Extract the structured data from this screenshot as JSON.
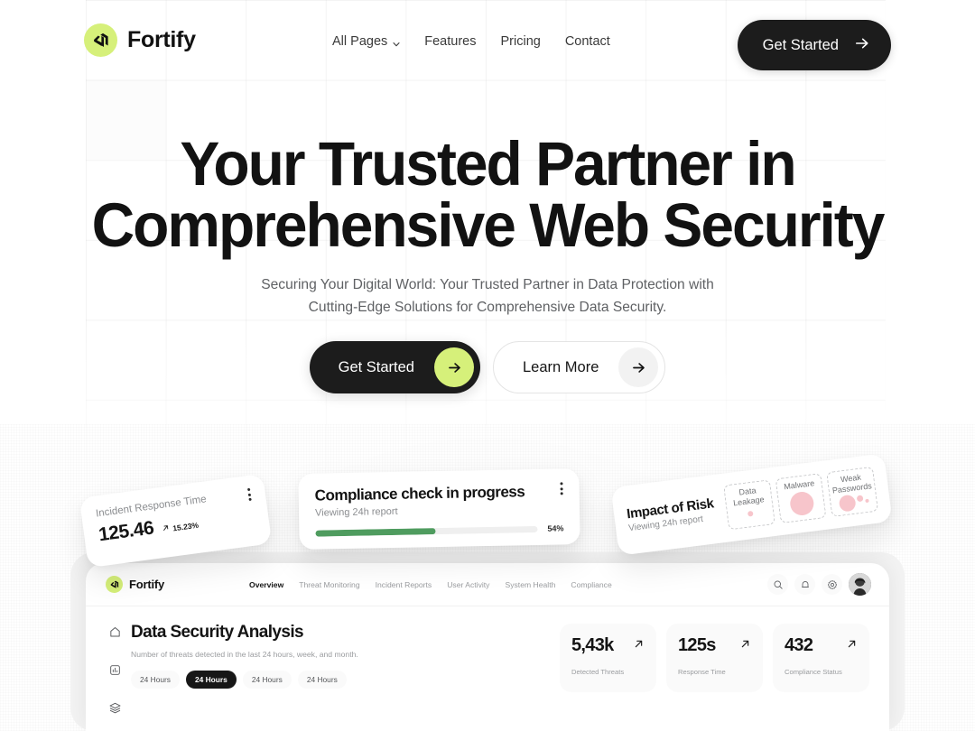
{
  "header": {
    "brand": "Fortify",
    "logo_icon": "fortify-logo-icon",
    "nav": [
      {
        "label": "All Pages",
        "has_chevron": true
      },
      {
        "label": "Features",
        "has_chevron": false
      },
      {
        "label": "Pricing",
        "has_chevron": false
      },
      {
        "label": "Contact",
        "has_chevron": false
      }
    ],
    "cta_label": "Get Started",
    "cta_icon": "arrow-right-icon"
  },
  "hero": {
    "title_line1": "Your Trusted Partner in",
    "title_line2": "Comprehensive Web Security",
    "subtitle": "Securing Your Digital World: Your Trusted Partner in Data Protection with Cutting-Edge Solutions for Comprehensive Data Security.",
    "primary_label": "Get Started",
    "secondary_label": "Learn More",
    "arrow_icon": "arrow-right-icon"
  },
  "cards": {
    "incident": {
      "label": "Incident Response Time",
      "value": "125.46",
      "delta": "15.23%",
      "delta_icon": "arrow-up-right-icon",
      "menu_icon": "more-vertical-icon"
    },
    "compliance": {
      "title": "Compliance check in progress",
      "subtitle": "Viewing 24h report",
      "progress_label": "54%",
      "progress_value": 54,
      "bar_color": "#4f9c5f",
      "menu_icon": "more-vertical-icon"
    },
    "risk": {
      "title": "Impact of Risk",
      "subtitle": "Viewing 24h report",
      "cells": [
        {
          "label": "Data Leakage",
          "bubbles": [
            6
          ]
        },
        {
          "label": "Malware",
          "bubbles": [
            26
          ]
        },
        {
          "label": "Weak Passwords",
          "bubbles": [
            18,
            7,
            4
          ]
        }
      ],
      "bubble_color": "#f7c5cb"
    }
  },
  "dashboard": {
    "brand": "Fortify",
    "logo_icon": "fortify-logo-icon",
    "nav": [
      "Overview",
      "Threat Monitoring",
      "Incident Reports",
      "User Activity",
      "System Health",
      "Compliance"
    ],
    "nav_active_index": 0,
    "actions": [
      {
        "name": "search-icon"
      },
      {
        "name": "bell-icon"
      },
      {
        "name": "gear-icon"
      }
    ],
    "avatar_name": "user-avatar",
    "rail_icons": [
      "home-icon",
      "analytics-icon",
      "layers-icon"
    ],
    "heading": "Data Security Analysis",
    "description": "Number of threats detected in the last 24 hours, week, and month.",
    "chips": [
      "24 Hours",
      "24 Hours",
      "24 Hours",
      "24 Hours"
    ],
    "chip_active_index": 1,
    "stats": [
      {
        "value": "5,43k",
        "label": "Detected Threats",
        "trend_icon": "arrow-up-right-icon"
      },
      {
        "value": "125s",
        "label": "Response Time",
        "trend_icon": "arrow-up-right-icon"
      },
      {
        "value": "432",
        "label": "Compliance Status",
        "trend_icon": "arrow-up-right-icon"
      }
    ]
  },
  "colors": {
    "accent_lime": "#d6f07a",
    "dark": "#1c1c1c",
    "green": "#4f9c5f",
    "pink": "#f7c5cb"
  }
}
